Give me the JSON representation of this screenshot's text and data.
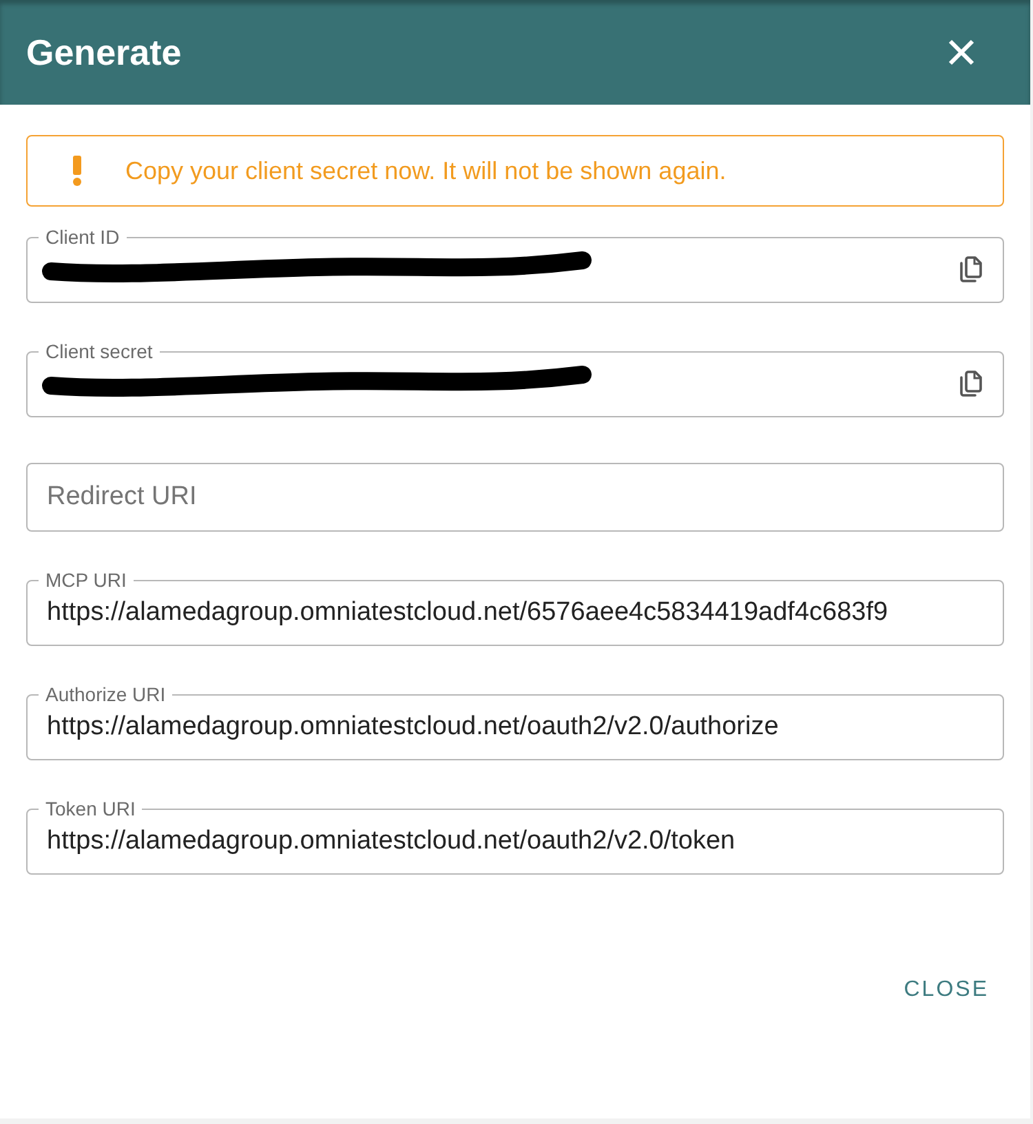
{
  "dialog": {
    "title": "Generate"
  },
  "alert": {
    "kind": "warning",
    "message": "Copy your client secret now. It will not be shown again."
  },
  "fields": [
    {
      "kind": "redacted",
      "label": "Client ID",
      "copyable": true
    },
    {
      "kind": "redacted",
      "label": "Client secret",
      "copyable": true
    },
    {
      "kind": "empty",
      "placeholder": "Redirect URI",
      "copyable": false
    },
    {
      "kind": "filled",
      "label": "MCP URI",
      "value": "https://alamedagroup.omniatestcloud.net/6576aee4c5834419adf4c683f9",
      "copyable": false
    },
    {
      "kind": "filled",
      "label": "Authorize URI",
      "value": "https://alamedagroup.omniatestcloud.net/oauth2/v2.0/authorize",
      "copyable": false
    },
    {
      "kind": "filled",
      "label": "Token URI",
      "value": "https://alamedagroup.omniatestcloud.net/oauth2/v2.0/token",
      "copyable": false
    }
  ],
  "buttons": [
    {
      "label": "CLOSE"
    }
  ]
}
